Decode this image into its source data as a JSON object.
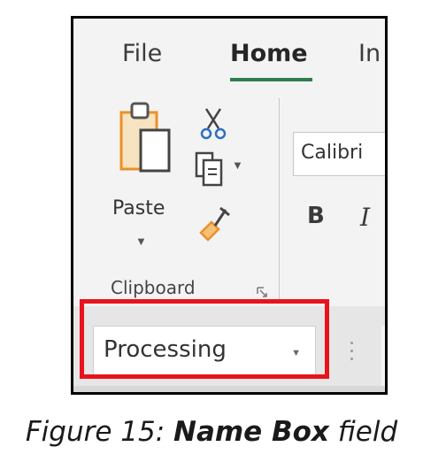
{
  "ribbon": {
    "tabs": [
      {
        "label": "File"
      },
      {
        "label": "Home",
        "selected": true
      },
      {
        "label": "In"
      }
    ],
    "accent_color": "#2e7d4f",
    "clipboard": {
      "paste_label": "Paste",
      "group_label": "Clipboard",
      "icons": [
        "paste-icon",
        "scissors-icon",
        "copy-icon",
        "format-painter-icon",
        "dialog-launcher-icon"
      ]
    },
    "font": {
      "font_name": "Calibri",
      "bold_label": "B",
      "italic_label": "I"
    }
  },
  "formula_bar": {
    "name_box_value": "Processing"
  },
  "highlight_color": "#e8141c",
  "caption": {
    "prefix": "Figure 15: ",
    "bold": "Name Box",
    "suffix": " field"
  }
}
